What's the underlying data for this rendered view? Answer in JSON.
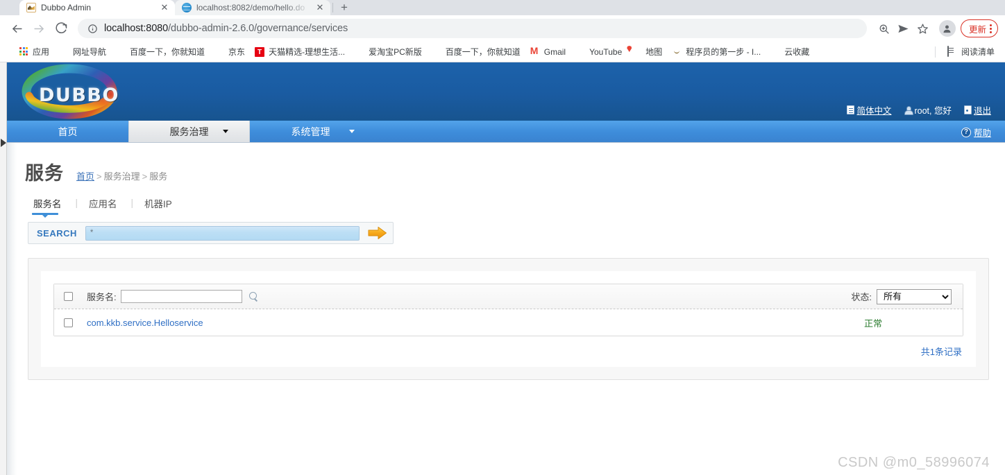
{
  "browser": {
    "tabs": [
      {
        "title": "Dubbo Admin",
        "favicon": "dubbo-favicon",
        "active": true
      },
      {
        "title": "localhost:8082/demo/hello.do",
        "favicon": "globe-favicon",
        "active": false
      }
    ],
    "new_tab_label": "+",
    "close_label": "✕",
    "nav": {
      "back": "back-arrow",
      "forward": "forward-arrow",
      "reload": "reload-arrow"
    },
    "omnibox": {
      "info_icon": "info-circle-icon",
      "url_host": "localhost:8080",
      "url_path": "/dubbo-admin-2.6.0/governance/services",
      "full_url": "localhost:8080/dubbo-admin-2.6.0/governance/services"
    },
    "toolbar_icons": [
      "zoom-in-icon",
      "send-icon",
      "star-icon",
      "profile-avatar"
    ],
    "update_button": {
      "label": "更新",
      "color": "#d93025"
    },
    "bookmarks": [
      {
        "label": "应用",
        "icon": "apps-grid-icon"
      },
      {
        "label": "网址导航",
        "icon": "globe-icon"
      },
      {
        "label": "百度一下，你就知道",
        "icon": "globe-icon"
      },
      {
        "label": "京东",
        "icon": "globe-icon"
      },
      {
        "label": "天猫精选-理想生活...",
        "icon": "tmall-icon"
      },
      {
        "label": "爱淘宝PC新版",
        "icon": "globe-icon"
      },
      {
        "label": "百度一下，你就知道",
        "icon": "globe-icon"
      },
      {
        "label": "Gmail",
        "icon": "gmail-icon"
      },
      {
        "label": "YouTube",
        "icon": "youtube-icon"
      },
      {
        "label": "地图",
        "icon": "maps-icon"
      },
      {
        "label": "程序员的第一步 - I...",
        "icon": "smiley-icon"
      },
      {
        "label": "云收藏",
        "icon": "globe-icon"
      }
    ],
    "reading_list": {
      "label": "阅读清单",
      "icon": "reading-list-icon"
    }
  },
  "app": {
    "logo_text": "DUBBO",
    "header_links": {
      "language": "简体中文",
      "greeting": "root, 您好",
      "logout": "退出"
    },
    "nav_items": [
      {
        "label": "首页",
        "active": false,
        "has_caret": false
      },
      {
        "label": "服务治理",
        "active": true,
        "has_caret": true
      },
      {
        "label": "系统管理",
        "active": false,
        "has_caret": true
      }
    ],
    "help": "帮助"
  },
  "page": {
    "title": "服务",
    "breadcrumb": {
      "home": "首页",
      "sep": ">",
      "level2": "服务治理",
      "level3": "服务"
    },
    "sub_tabs": [
      {
        "label": "服务名",
        "active": true
      },
      {
        "label": "应用名",
        "active": false
      },
      {
        "label": "机器IP",
        "active": false
      }
    ],
    "tab_divider": "|",
    "search": {
      "label": "SEARCH",
      "value": "*",
      "placeholder": "*",
      "go_icon": "orange-arrow-icon"
    }
  },
  "table": {
    "header": {
      "select_all_checkbox": "",
      "name_label": "服务名:",
      "name_filter_value": "",
      "name_filter_placeholder": "",
      "search_icon": "magnifier-icon",
      "status_label": "状态:",
      "status_selected": "所有",
      "status_options": [
        "所有"
      ]
    },
    "rows": [
      {
        "checked": false,
        "service_name": "com.kkb.service.Helloservice",
        "status": "正常",
        "status_color": "#2e7d32"
      }
    ],
    "footer_total": "共1条记录"
  },
  "watermark": "CSDN @m0_58996074"
}
